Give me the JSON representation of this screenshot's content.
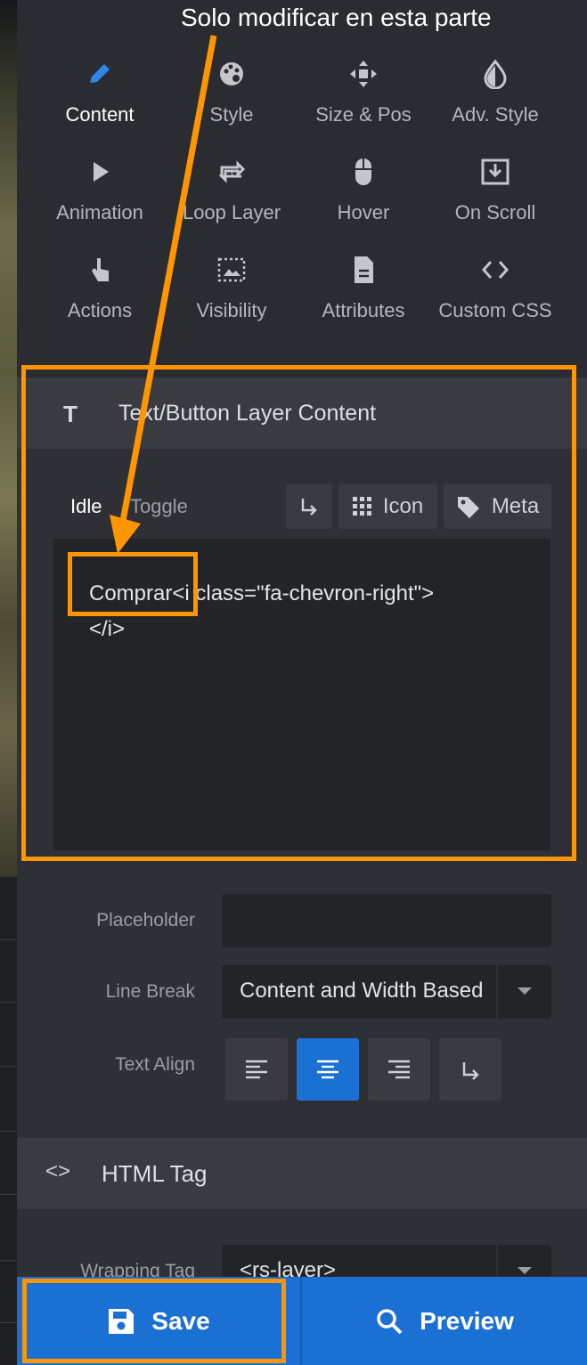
{
  "annotation": {
    "text": "Solo modificar en esta parte"
  },
  "tabs": [
    {
      "label": "Content",
      "icon": "pencil-icon",
      "active": true
    },
    {
      "label": "Style",
      "icon": "palette-icon"
    },
    {
      "label": "Size & Pos",
      "icon": "move-icon"
    },
    {
      "label": "Adv. Style",
      "icon": "contrast-icon"
    },
    {
      "label": "Animation",
      "icon": "play-icon"
    },
    {
      "label": "Loop Layer",
      "icon": "loop-icon"
    },
    {
      "label": "Hover",
      "icon": "mouse-icon"
    },
    {
      "label": "On Scroll",
      "icon": "scroll-icon"
    },
    {
      "label": "Actions",
      "icon": "touch-icon"
    },
    {
      "label": "Visibility",
      "icon": "visibility-icon"
    },
    {
      "label": "Attributes",
      "icon": "document-icon"
    },
    {
      "label": "Custom CSS",
      "icon": "code-icon"
    }
  ],
  "text_section": {
    "header_icon": "T",
    "title": "Text/Button Layer Content",
    "mode_idle": "Idle",
    "mode_toggle": "Toggle",
    "icon_button": "Icon",
    "meta_button": "Meta",
    "content": "Comprar<i class=\"fa-chevron-right\">\n</i>"
  },
  "placeholder": {
    "label": "Placeholder",
    "value": ""
  },
  "line_break": {
    "label": "Line Break",
    "value": "Content and Width Based"
  },
  "text_align": {
    "label": "Text Align",
    "selected": "center"
  },
  "html_tag": {
    "header_icon": "<>",
    "title": "HTML Tag",
    "wrapping_label": "Wrapping Tag",
    "wrapping_value": "<rs-layer>"
  },
  "footer": {
    "save": "Save",
    "preview": "Preview"
  },
  "colors": {
    "accent": "#1a70d3",
    "annotation": "#ff9500",
    "panel": "#2b2c31"
  }
}
